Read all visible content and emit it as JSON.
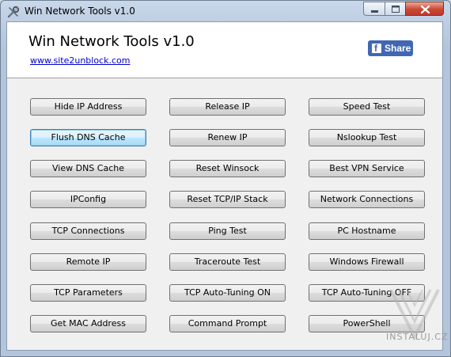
{
  "window": {
    "title": "Win Network Tools v1.0"
  },
  "header": {
    "app_title": "Win Network Tools v1.0",
    "site_link": "www.site2unblock.com",
    "share_label": "Share"
  },
  "buttons": {
    "col1": [
      "Hide IP Address",
      "Flush DNS Cache",
      "View DNS Cache",
      "IPConfig",
      "TCP Connections",
      "Remote IP",
      "TCP Parameters",
      "Get MAC Address"
    ],
    "col2": [
      "Release IP",
      "Renew IP",
      "Reset Winsock",
      "Reset TCP/IP Stack",
      "Ping Test",
      "Traceroute Test",
      "TCP Auto-Tuning ON",
      "Command Prompt"
    ],
    "col3": [
      "Speed Test",
      "Nslookup Test",
      "Best VPN Service",
      "Network Connections",
      "PC Hostname",
      "Windows Firewall",
      "TCP Auto-Tuning OFF",
      "PowerShell"
    ]
  },
  "watermark": {
    "text": "INSTALUJ.CZ"
  },
  "colors": {
    "facebook_blue": "#4267b2",
    "link_blue": "#0000cc",
    "close_red": "#c84834"
  }
}
